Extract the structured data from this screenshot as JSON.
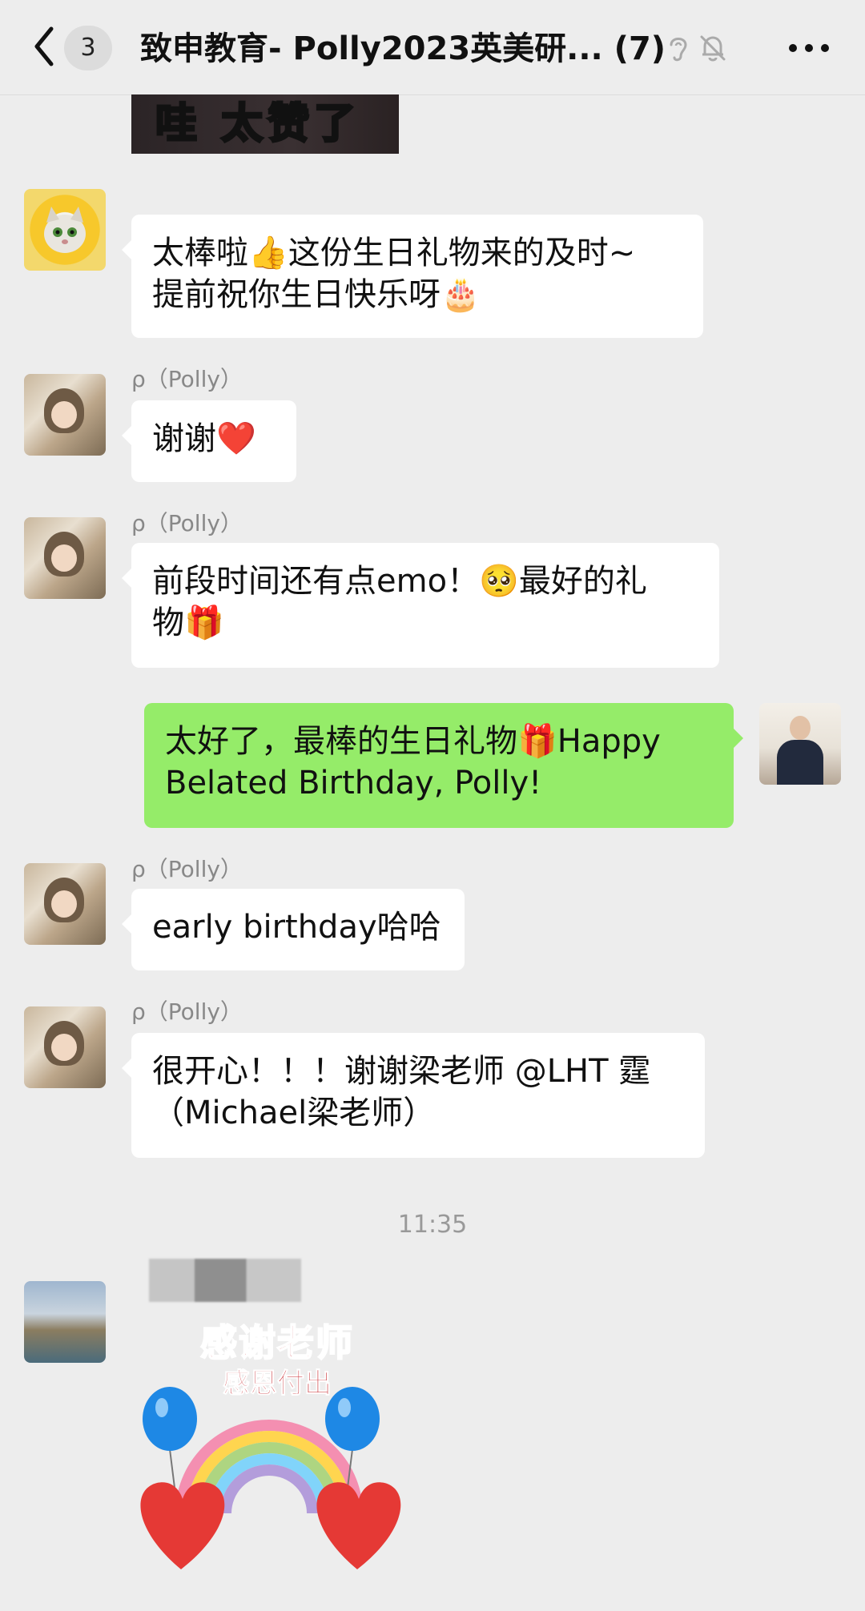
{
  "header": {
    "back_count": "3",
    "title": "致申教育- Polly2023英美研... (7)"
  },
  "top_image": {
    "caption": "哇 太赞了"
  },
  "messages": [
    {
      "sender": "",
      "lines": [
        "太棒啦👍这份生日礼物来的及时~",
        "提前祝你生日快乐呀🎂"
      ]
    },
    {
      "sender": "ρ（Polly）",
      "lines": [
        "谢谢❤️"
      ]
    },
    {
      "sender": "ρ（Polly）",
      "lines": [
        "前段时间还有点emo！🥺最好的礼",
        "物🎁"
      ]
    },
    {
      "sender": "",
      "lines": [
        "太好了，最棒的生日礼物🎁Happy",
        "Belated Birthday, Polly!"
      ]
    },
    {
      "sender": "ρ（Polly）",
      "lines": [
        "early birthday哈哈"
      ]
    },
    {
      "sender": "ρ（Polly）",
      "lines": [
        "很开心！！！谢谢梁老师 @LHT 霆",
        "（Michael梁老师）"
      ]
    }
  ],
  "timestamp": "11:35",
  "sticker": {
    "title": "感谢老师",
    "subtitle": "感恩付出"
  },
  "colors": {
    "background": "#ededed",
    "outgoing_bubble": "#95ec69",
    "incoming_bubble": "#ffffff"
  },
  "icons": [
    "back-chevron-icon",
    "ear-icon",
    "mute-bell-icon",
    "more-dots-icon"
  ]
}
